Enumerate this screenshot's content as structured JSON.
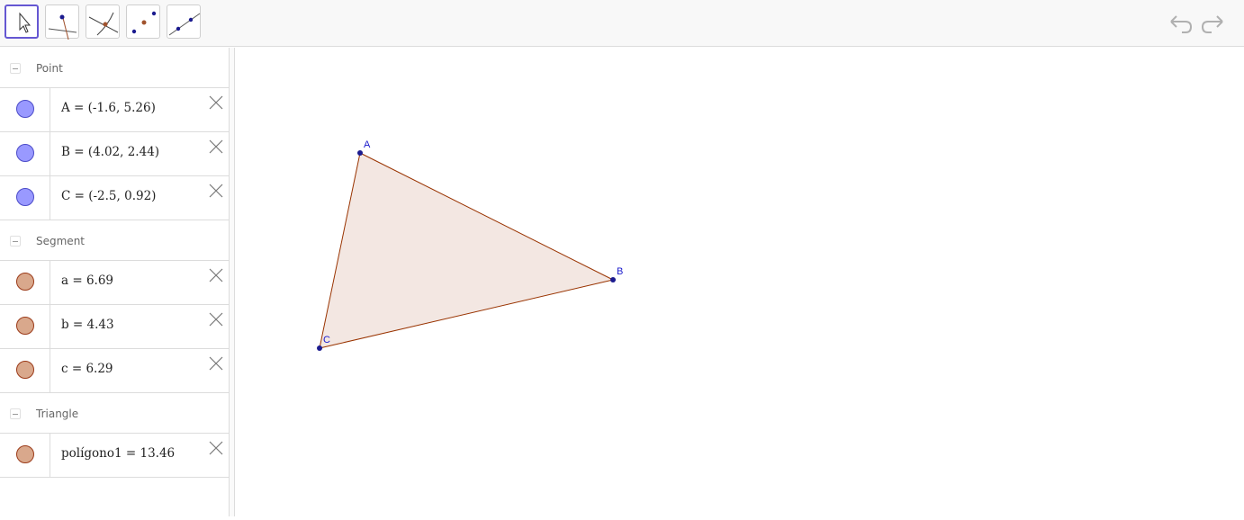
{
  "toolbar": {
    "tools": [
      {
        "name": "move-tool",
        "icon": "cursor-arrow-icon",
        "active": true
      },
      {
        "name": "point-tool",
        "icon": "point-on-line-icon",
        "active": false
      },
      {
        "name": "intersect-tool",
        "icon": "intersect-curves-icon",
        "active": false
      },
      {
        "name": "midpoint-tool",
        "icon": "midpoint-icon",
        "active": false
      },
      {
        "name": "line-tool",
        "icon": "line-through-points-icon",
        "active": false
      }
    ],
    "undo_icon": "undo-icon",
    "redo_icon": "redo-icon"
  },
  "algebra": {
    "groups": [
      {
        "label": "Point",
        "items": [
          {
            "text": "A = (-1.6, 5.26)",
            "color": "#9999ff",
            "stroke": "#4b4bc8"
          },
          {
            "text": "B = (4.02, 2.44)",
            "color": "#9999ff",
            "stroke": "#4b4bc8"
          },
          {
            "text": "C = (-2.5, 0.92)",
            "color": "#9999ff",
            "stroke": "#4b4bc8"
          }
        ]
      },
      {
        "label": "Segment",
        "items": [
          {
            "text": "a = 6.69",
            "color": "#d9a88c",
            "stroke": "#9b3a18"
          },
          {
            "text": "b = 4.43",
            "color": "#d9a88c",
            "stroke": "#9b3a18"
          },
          {
            "text": "c = 6.29",
            "color": "#d9a88c",
            "stroke": "#9b3a18"
          }
        ]
      },
      {
        "label": "Triangle",
        "items": [
          {
            "text": "polígono1 = 13.46",
            "color": "#d9a88c",
            "stroke": "#9b3a18"
          }
        ]
      }
    ]
  },
  "graphics": {
    "points": {
      "A": {
        "label": "A",
        "x": -1.6,
        "y": 5.26
      },
      "B": {
        "label": "B",
        "x": 4.02,
        "y": 2.44
      },
      "C": {
        "label": "C",
        "x": -2.5,
        "y": 0.92
      }
    },
    "point_color": "#1b1b8f",
    "label_color": "#1a1acc",
    "segment_color": "#993300",
    "polygon_fill": "#f3e7e2"
  }
}
